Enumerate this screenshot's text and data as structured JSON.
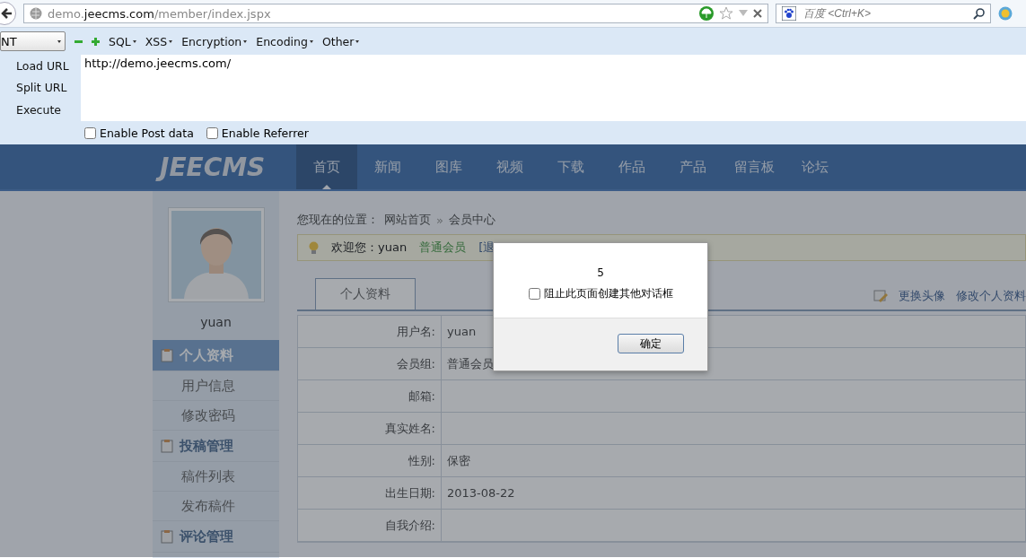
{
  "browser": {
    "url": {
      "prefix": "demo.",
      "domain": "jeecms.com",
      "path": "/member/index.jspx"
    },
    "search_placeholder": "百度 <Ctrl+K>"
  },
  "hackbar": {
    "select_value": "NT",
    "menus": [
      "SQL",
      "XSS",
      "Encryption",
      "Encoding",
      "Other"
    ],
    "actions": [
      "Load URL",
      "Split URL",
      "Execute"
    ],
    "url_text": "http://demo.jeecms.com/",
    "options": [
      {
        "label": "Enable Post data",
        "checked": false
      },
      {
        "label": "Enable Referrer",
        "checked": false
      }
    ]
  },
  "site": {
    "logo": "JEECMS",
    "nav": [
      {
        "label": "首页",
        "selected": true
      },
      {
        "label": "新闻",
        "selected": false
      },
      {
        "label": "图库",
        "selected": false
      },
      {
        "label": "视频",
        "selected": false
      },
      {
        "label": "下载",
        "selected": false
      },
      {
        "label": "作品",
        "selected": false
      },
      {
        "label": "产品",
        "selected": false
      },
      {
        "label": "留言板",
        "selected": false
      },
      {
        "label": "论坛",
        "selected": false
      }
    ],
    "sidebar": {
      "username": "yuan",
      "sections": [
        {
          "title": "个人资料",
          "selected": true,
          "items": [
            "用户信息",
            "修改密码"
          ]
        },
        {
          "title": "投稿管理",
          "selected": false,
          "items": [
            "稿件列表",
            "发布稿件"
          ]
        },
        {
          "title": "评论管理",
          "selected": false
        }
      ]
    },
    "breadcrumb": {
      "label": "您现在的位置：",
      "items": [
        "网站首页",
        "会员中心"
      ],
      "separator": "»"
    },
    "welcome": {
      "text": "欢迎您：yuan",
      "group": "普通会员",
      "link": "[退"
    },
    "tabs": [
      {
        "label": "个人资料",
        "selected": true
      }
    ],
    "tab_actions": [
      "更换头像",
      "修改个人资料"
    ],
    "rows": [
      {
        "label": "用户名:",
        "value": "yuan"
      },
      {
        "label": "会员组:",
        "value": "普通会员"
      },
      {
        "label": "邮箱:"
      },
      {
        "label": "真实姓名:"
      },
      {
        "label": "性别:",
        "value": "保密"
      },
      {
        "label": "出生日期:",
        "value": "2013-08-22"
      },
      {
        "label": "自我介绍:"
      }
    ]
  },
  "dialog": {
    "message": "5",
    "checkbox": {
      "label": "阻止此页面创建其他对话框",
      "checked": false
    },
    "button": "确定"
  }
}
